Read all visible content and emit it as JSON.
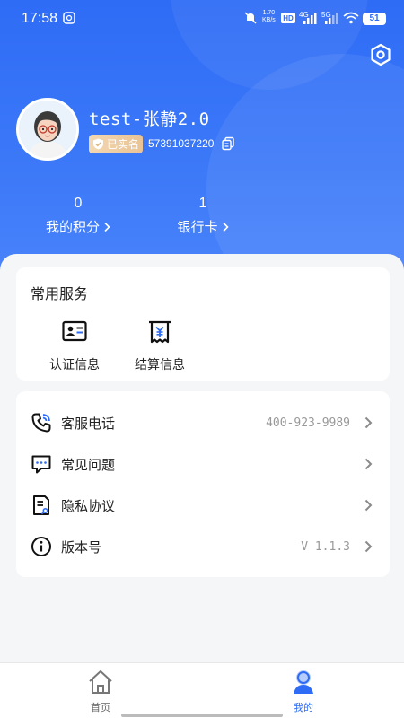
{
  "status_bar": {
    "time": "17:58",
    "net_speed_value": "1.70",
    "net_speed_unit": "KB/s",
    "signal1": "4G",
    "signal2": "5G",
    "battery": "51"
  },
  "profile": {
    "username": "test-张静2.0",
    "verified_label": "已实名",
    "phone": "57391037220"
  },
  "stats": [
    {
      "value": "0",
      "label": "我的积分"
    },
    {
      "value": "1",
      "label": "银行卡"
    }
  ],
  "services": {
    "title": "常用服务",
    "items": [
      {
        "label": "认证信息",
        "icon": "id-card-icon"
      },
      {
        "label": "结算信息",
        "icon": "receipt-yuan-icon"
      }
    ]
  },
  "menu": [
    {
      "label": "客服电话",
      "value": "400-923-9989",
      "icon": "phone-icon"
    },
    {
      "label": "常见问题",
      "value": "",
      "icon": "chat-question-icon"
    },
    {
      "label": "隐私协议",
      "value": "",
      "icon": "document-icon"
    },
    {
      "label": "版本号",
      "value": "V 1.1.3",
      "icon": "info-icon"
    }
  ],
  "tabbar": {
    "home": "首页",
    "mine": "我的"
  },
  "colors": {
    "primary": "#2e6cf6",
    "verified_badge": "#e9c394"
  }
}
